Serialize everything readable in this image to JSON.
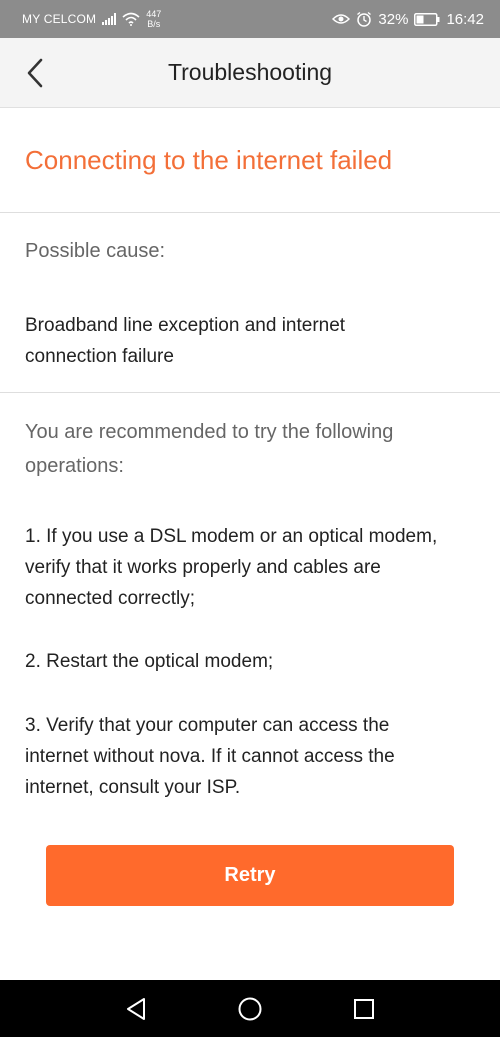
{
  "status_bar": {
    "carrier": "MY CELCOM",
    "net_speed_value": "447",
    "net_speed_unit": "B/s",
    "battery": "32%",
    "time": "16:42",
    "icons": [
      "signal-icon",
      "wifi-icon",
      "eye-icon",
      "alarm-icon",
      "battery-icon"
    ]
  },
  "header": {
    "title": "Troubleshooting",
    "back_icon": "chevron-left-icon"
  },
  "error": {
    "title": "Connecting to the internet failed",
    "color": "#f36f38"
  },
  "cause": {
    "label": "Possible cause:",
    "line1": "Broadband line exception and internet",
    "line2": "connection failure"
  },
  "operations": {
    "label_line1": "You are recommended to try the following",
    "label_line2": "operations:",
    "step1_line1": "1. If you use a DSL modem or an optical modem,",
    "step1_line2": "verify that it works properly and cables are",
    "step1_line3": "connected correctly;",
    "step2_line1": "2. Restart the optical modem;",
    "step3_line1": "3. Verify that your computer can access the",
    "step3_line2": "internet without nova. If it cannot access the",
    "step3_line3": "internet, consult your ISP."
  },
  "retry_button": {
    "label": "Retry",
    "color": "#ff6a2c"
  },
  "nav_bar": {
    "icons": [
      "back-triangle-icon",
      "home-circle-icon",
      "recents-square-icon"
    ]
  }
}
